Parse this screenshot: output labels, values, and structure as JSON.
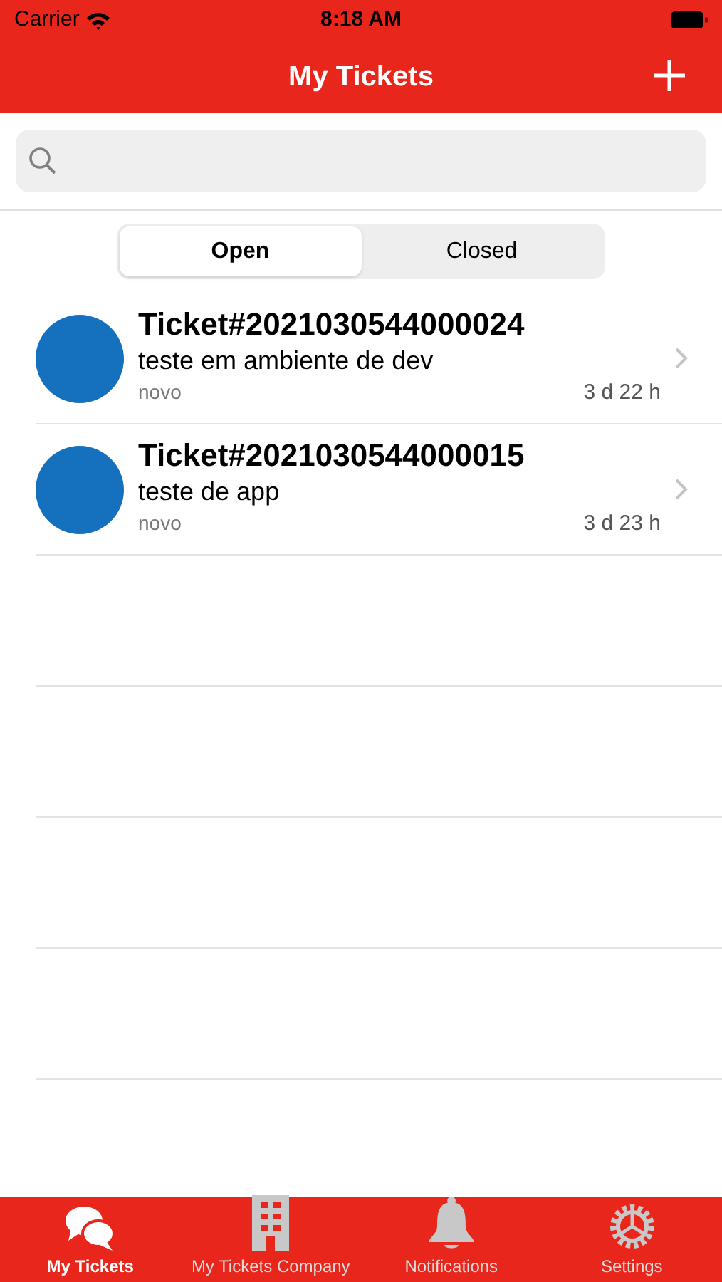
{
  "status_bar": {
    "carrier": "Carrier",
    "time": "8:18 AM"
  },
  "nav_bar": {
    "title": "My Tickets"
  },
  "segments": [
    {
      "label": "Open",
      "selected": true
    },
    {
      "label": "Closed",
      "selected": false
    }
  ],
  "tickets": [
    {
      "title": "Ticket#2021030544000024",
      "subject": "teste em ambiente de dev",
      "state": "novo",
      "age": "3 d 22 h"
    },
    {
      "title": "Ticket#2021030544000015",
      "subject": "teste de app",
      "state": "novo",
      "age": "3 d 23 h"
    }
  ],
  "tab_bar": [
    {
      "kind": "chat",
      "label": "My Tickets",
      "selected": true
    },
    {
      "kind": "building",
      "label": "My Tickets Company",
      "selected": false
    },
    {
      "kind": "bell",
      "label": "Notifications",
      "selected": false
    },
    {
      "kind": "gear",
      "label": "Settings",
      "selected": false
    }
  ]
}
